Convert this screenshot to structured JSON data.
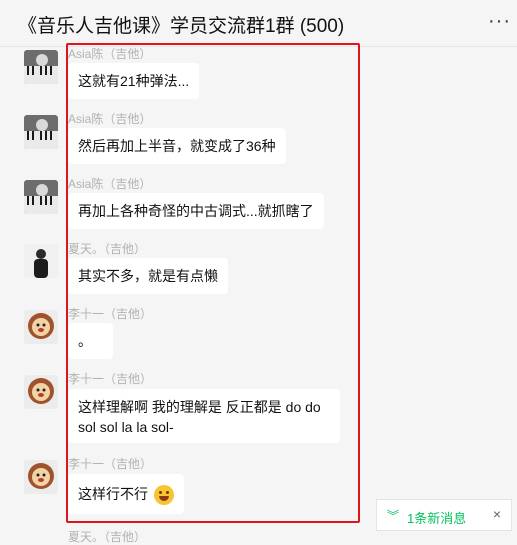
{
  "header": {
    "title": "《音乐人吉他课》学员交流群1群 (500)",
    "more_label": "···"
  },
  "messages": [
    {
      "sender": "Asia陈（吉他）",
      "text": "这就有21种弹法...",
      "avatar": "piano-photo"
    },
    {
      "sender": "Asia陈（吉他）",
      "text": "然后再加上半音，就变成了36种",
      "avatar": "piano-photo"
    },
    {
      "sender": "Asia陈（吉他）",
      "text": "再加上各种奇怪的中古调式...就抓瞎了",
      "avatar": "piano-photo"
    },
    {
      "sender": "夏天。（吉他）",
      "text": "其实不多，就是有点懒",
      "avatar": "person-photo"
    },
    {
      "sender": "李十一（吉他）",
      "text": "。",
      "avatar": "lion-avatar"
    },
    {
      "sender": "李十一（吉他）",
      "text": "这样理解啊 我的理解是 反正都是 do do sol sol la la sol-",
      "avatar": "lion-avatar"
    },
    {
      "sender": "李十一（吉他）",
      "text": "这样行不行",
      "avatar": "lion-avatar",
      "emoji": "laughing-tears-emoji"
    }
  ],
  "peek_sender": "夏天。（吉他）",
  "new_message_banner": {
    "label": "1条新消息",
    "chevron": "double-chevron-down-icon",
    "close": "×"
  },
  "colors": {
    "highlight": "#e0141b",
    "accent_green": "#07c160",
    "background": "#f5f5f5"
  }
}
